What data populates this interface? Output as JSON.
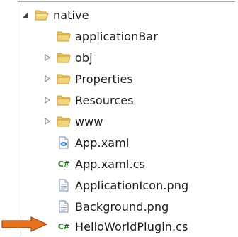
{
  "tree": {
    "root": {
      "label": "native",
      "icon": "folder-open-icon",
      "expanded": true
    },
    "children": [
      {
        "label": "applicationBar",
        "icon": "folder-icon",
        "expandable": false
      },
      {
        "label": "obj",
        "icon": "folder-icon",
        "expandable": true
      },
      {
        "label": "Properties",
        "icon": "folder-icon",
        "expandable": true
      },
      {
        "label": "Resources",
        "icon": "folder-icon",
        "expandable": true
      },
      {
        "label": "www",
        "icon": "folder-icon",
        "expandable": true
      },
      {
        "label": "App.xaml",
        "icon": "xaml-file-icon"
      },
      {
        "label": "App.xaml.cs",
        "icon": "csharp-file-icon",
        "badge": "C#"
      },
      {
        "label": "ApplicationIcon.png",
        "icon": "document-icon"
      },
      {
        "label": "Background.png",
        "icon": "document-icon"
      },
      {
        "label": "HelloWorldPlugin.cs",
        "icon": "csharp-file-icon",
        "badge": "C#"
      }
    ]
  },
  "colors": {
    "folder_fill": "#f2d27a",
    "folder_stroke": "#c89b2c",
    "arrow": "#e8731f",
    "csharp_green": "#2d7a2d"
  }
}
